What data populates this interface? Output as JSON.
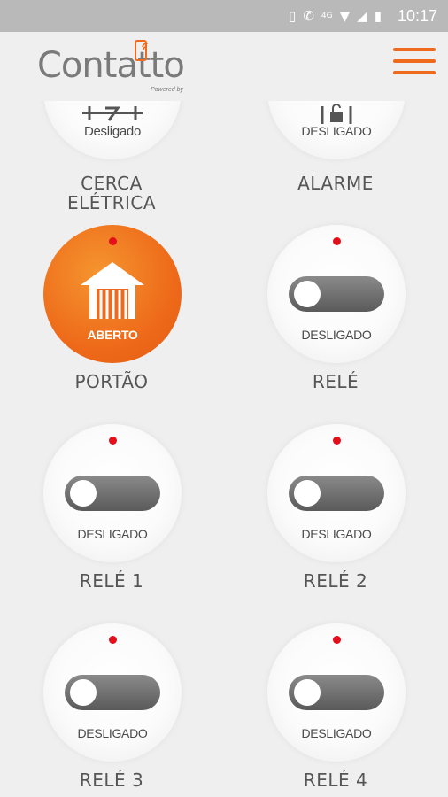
{
  "status_bar": {
    "time": "10:17",
    "network": "4G"
  },
  "app": {
    "logo_text": "Contatto",
    "logo_sub": "Powered by"
  },
  "tiles": [
    {
      "label": "CERCA ELÉTRICA",
      "state": "Desligado"
    },
    {
      "label": "ALARME",
      "state": "DESLIGADO"
    },
    {
      "label": "PORTÃO",
      "state": "ABERTO"
    },
    {
      "label": "RELÉ",
      "state": "DESLIGADO"
    },
    {
      "label": "RELÉ 1",
      "state": "DESLIGADO"
    },
    {
      "label": "RELÉ 2",
      "state": "DESLIGADO"
    },
    {
      "label": "RELÉ 3",
      "state": "DESLIGADO"
    },
    {
      "label": "RELÉ 4",
      "state": "DESLIGADO"
    }
  ],
  "colors": {
    "accent": "#ef6a1c",
    "led": "#e3101b",
    "toggle_off": "#6b6b6b"
  }
}
